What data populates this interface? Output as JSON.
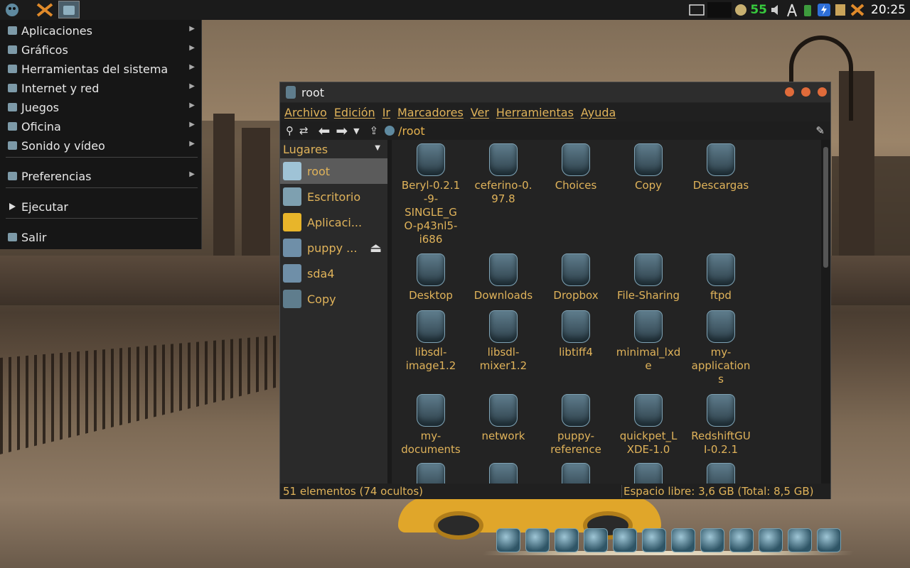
{
  "top_panel": {
    "clock": "20:25",
    "battery": "55"
  },
  "menu": {
    "items": [
      {
        "label": "Aplicaciones",
        "icon": "applications-icon",
        "submenu": true
      },
      {
        "label": "Gráficos",
        "icon": "graphics-icon",
        "submenu": true
      },
      {
        "label": "Herramientas del sistema",
        "icon": "system-tools-icon",
        "submenu": true
      },
      {
        "label": "Internet y red",
        "icon": "internet-icon",
        "submenu": true
      },
      {
        "label": "Juegos",
        "icon": "games-icon",
        "submenu": true
      },
      {
        "label": "Oficina",
        "icon": "office-icon",
        "submenu": true
      },
      {
        "label": "Sonido y vídeo",
        "icon": "sound-video-icon",
        "submenu": true
      },
      {
        "label": "Preferencias",
        "icon": "preferences-icon",
        "submenu": true
      },
      {
        "label": "Ejecutar",
        "icon": "run-icon",
        "submenu": false
      },
      {
        "label": "Salir",
        "icon": "logout-icon",
        "submenu": false
      }
    ]
  },
  "window": {
    "title": "root",
    "menubar": [
      "Archivo",
      "Edición",
      "Ir",
      "Marcadores",
      "Ver",
      "Herramientas",
      "Ayuda"
    ],
    "path": "/root",
    "sidebar": {
      "header": "Lugares",
      "places": [
        {
          "label": "root",
          "selected": true
        },
        {
          "label": "Escritorio",
          "selected": false
        },
        {
          "label": "Aplicaci...",
          "selected": false
        },
        {
          "label": "puppy ...",
          "selected": false,
          "eject": true
        },
        {
          "label": "sda4",
          "selected": false
        },
        {
          "label": "Copy",
          "selected": false
        }
      ]
    },
    "files": [
      [
        "Beryl-0.2.1",
        "-9-",
        "SINGLE_G",
        "O-p43nl5-",
        "i686"
      ],
      [
        "ceferino-0.",
        "97.8"
      ],
      [
        "Choices"
      ],
      [
        "Copy"
      ],
      [
        "Descargas"
      ],
      [
        "Desktop"
      ],
      [
        "Downloads"
      ],
      [
        "Dropbox"
      ],
      [
        "File-Sharing"
      ],
      [
        "ftpd"
      ],
      [
        "libsdl-",
        "image1.2"
      ],
      [
        "libsdl-",
        "mixer1.2"
      ],
      [
        "libtiff4"
      ],
      [
        "minimal_lxd",
        "e"
      ],
      [
        "my-",
        "application",
        "s"
      ],
      [
        "my-",
        "documents"
      ],
      [
        "network"
      ],
      [
        "puppy-",
        "reference"
      ],
      [
        "quickpet_L",
        "XDE-1.0"
      ],
      [
        "RedshiftGU",
        "I-0.2.1"
      ],
      [
        ""
      ],
      [
        ""
      ],
      [
        ""
      ],
      [
        ""
      ],
      [
        ""
      ]
    ],
    "status_left": "51 elementos (74 ocultos)",
    "status_right": "Espacio libre: 3,6 GB (Total: 8,5 GB)"
  },
  "colors": {
    "accent_text": "#e0b35a",
    "panel_bg": "#1b1b1b",
    "selection": "#5b5b5b"
  }
}
